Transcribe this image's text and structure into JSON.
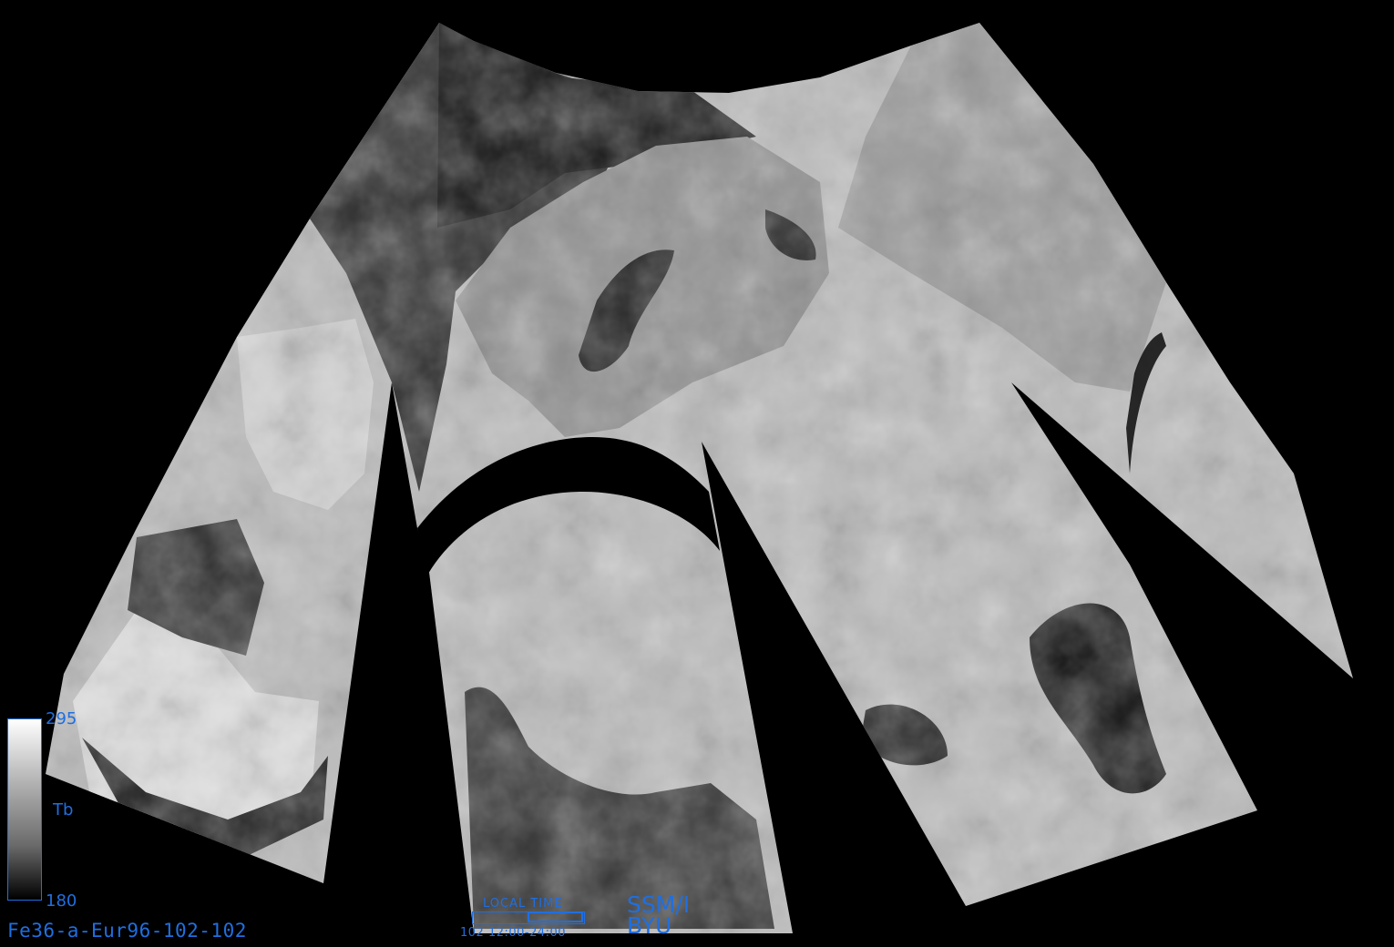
{
  "image_id": "Fe36-a-Eur96-102-102",
  "colorbar": {
    "max_label": "295",
    "min_label": "180",
    "variable_label": "Tb",
    "colors": [
      "#ffffff",
      "#000000"
    ],
    "accent_color": "#1f6fe0"
  },
  "local_time": {
    "label": "LOCAL TIME",
    "range_text": "102 12:00-24:00"
  },
  "sensor": {
    "line1": "SSM/I",
    "line2": "BYU"
  }
}
